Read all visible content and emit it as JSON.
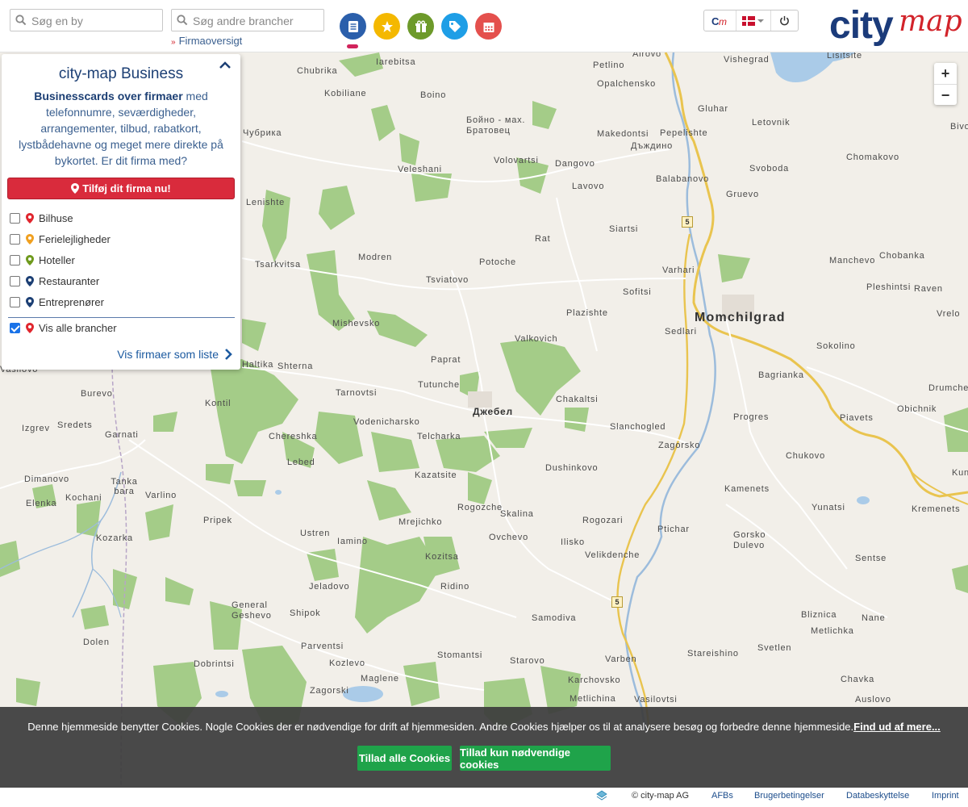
{
  "header": {
    "search_city_placeholder": "Søg en by",
    "search_branch_placeholder": "Søg andre brancher",
    "overview_link": "Firmaoversigt",
    "categories": [
      {
        "name": "businesscards",
        "color": "#2b5fab",
        "icon": "card-icon"
      },
      {
        "name": "sights",
        "color": "#f4b800",
        "icon": "star-icon"
      },
      {
        "name": "events",
        "color": "#6d9a2a",
        "icon": "gift-icon"
      },
      {
        "name": "offers",
        "color": "#1e9ee6",
        "icon": "tag-icon"
      },
      {
        "name": "calendar",
        "color": "#e4504d",
        "icon": "calendar-icon"
      }
    ],
    "logo_city": "city",
    "logo_map": "map"
  },
  "panel": {
    "title": "city-map Business",
    "desc_bold": "Businesscards over firmaer",
    "desc_rest": " med telefonnumre, seværdigheder, arrangementer, tilbud, rabatkort, lystbådehavne og meget mere direkte på bykortet. Er dit firma med?",
    "add_button": "Tilføj dit firma nu!",
    "categories": [
      {
        "label": "Bilhuse",
        "pin_color": "#e0262e",
        "checked": false
      },
      {
        "label": "Ferielejligheder",
        "pin_color": "#f0a020",
        "checked": false
      },
      {
        "label": "Hoteller",
        "pin_color": "#6f9a1d",
        "checked": false
      },
      {
        "label": "Restauranter",
        "pin_color": "#1c3f74",
        "checked": false
      },
      {
        "label": "Entreprenører",
        "pin_color": "#1c3f74",
        "checked": false
      }
    ],
    "show_all": {
      "label": "Vis alle brancher",
      "pin_color": "#e0262e",
      "checked": true
    },
    "list_link": "Vis firmaer som liste"
  },
  "map": {
    "zoom_in": "+",
    "zoom_out": "−",
    "road_number": "5",
    "places": [
      "Airovo",
      "Vishegrad",
      "Lisitsite",
      "Petlino",
      "Opalchensko",
      "Iarebitsa",
      "Chubrika",
      "Kobiliane",
      "Boino",
      "Бойно - мах.",
      "Братовец",
      "Gluhar",
      "Letovnik",
      "Bivolya",
      "Makedontsi",
      "Pepelishte",
      "Дъждино",
      "Chomakovo",
      "Чубрика",
      "Veleshani",
      "Volovartsi",
      "Dangovo",
      "Lavovo",
      "Balabanovo",
      "Svoboda",
      "Gruevo",
      "Lenishte",
      "Siartsi",
      "Rat",
      "Tsarkvitsa",
      "Modren",
      "Potoche",
      "Varhari",
      "Manchevo",
      "Chobanka",
      "Tsviatovo",
      "Sofitsi",
      "Pleshintsi",
      "Raven",
      "Plazishte",
      "Momchilgrad",
      "Vrelo",
      "Mishevsko",
      "Sedlari",
      "Valkovich",
      "Sokolino",
      "Shterna",
      "Paprat",
      "Haltika",
      "Bagrianka",
      "Tutunche",
      "Tarnovtsi",
      "Burevo",
      "Kontil",
      "Chakaltsi",
      "Drumche",
      "Джебел",
      "Obichnik",
      "Sredets",
      "Vodenicharsko",
      "Slanchogled",
      "Piavets",
      "Izgrev",
      "Garnati",
      "Chereshka",
      "Telcharka",
      "Progres",
      "Zagorsko",
      "Lebed",
      "Chukovo",
      "Dushinkovo",
      "Tanka bara",
      "Dimanovo",
      "Kazatsite",
      "Kamenets",
      "Kochani",
      "Varlino",
      "Elenka",
      "Rogozche",
      "Yunatsi",
      "Kremenets",
      "Skalina",
      "Pripek",
      "Rogozari",
      "Mrejichko",
      "Ptichar",
      "Ustren",
      "Ovchevo",
      "Kozarka",
      "Iamino",
      "Ilisko",
      "Gorsko Dulevo",
      "Velikdenche",
      "Kozitsa",
      "Sentse",
      "Ridino",
      "Jeladovo",
      "General Geshevo",
      "Shipok",
      "Samodiva",
      "Bliznica",
      "Nane",
      "Metlichka",
      "Dolen",
      "Parventsi",
      "Stomantsi",
      "Stareishino",
      "Svetlen",
      "Dobrintsi",
      "Kozlevo",
      "Starovo",
      "Varben",
      "Maglene",
      "Karchovsko",
      "Chavka",
      "Zagorski",
      "Metlichina",
      "Vasilovtsi",
      "Auslovo",
      "Kundevo",
      "Vasilovo"
    ]
  },
  "cookie": {
    "message": "Denne hjemmeside benytter Cookies. Nogle Cookies der er nødvendige for drift af hjemmesiden. Andre Cookies hjælper os til at analysere besøg og forbedre denne hjemmeside.",
    "more_link": "Find ud af mere...",
    "accept_all": "Tillad alle Cookies",
    "accept_needed": "Tillad kun nødvendige cookies"
  },
  "footer": {
    "copyright": "© city-map AG",
    "links": [
      "AFBs",
      "Brugerbetingelser",
      "Databeskyttelse",
      "Imprint"
    ]
  }
}
